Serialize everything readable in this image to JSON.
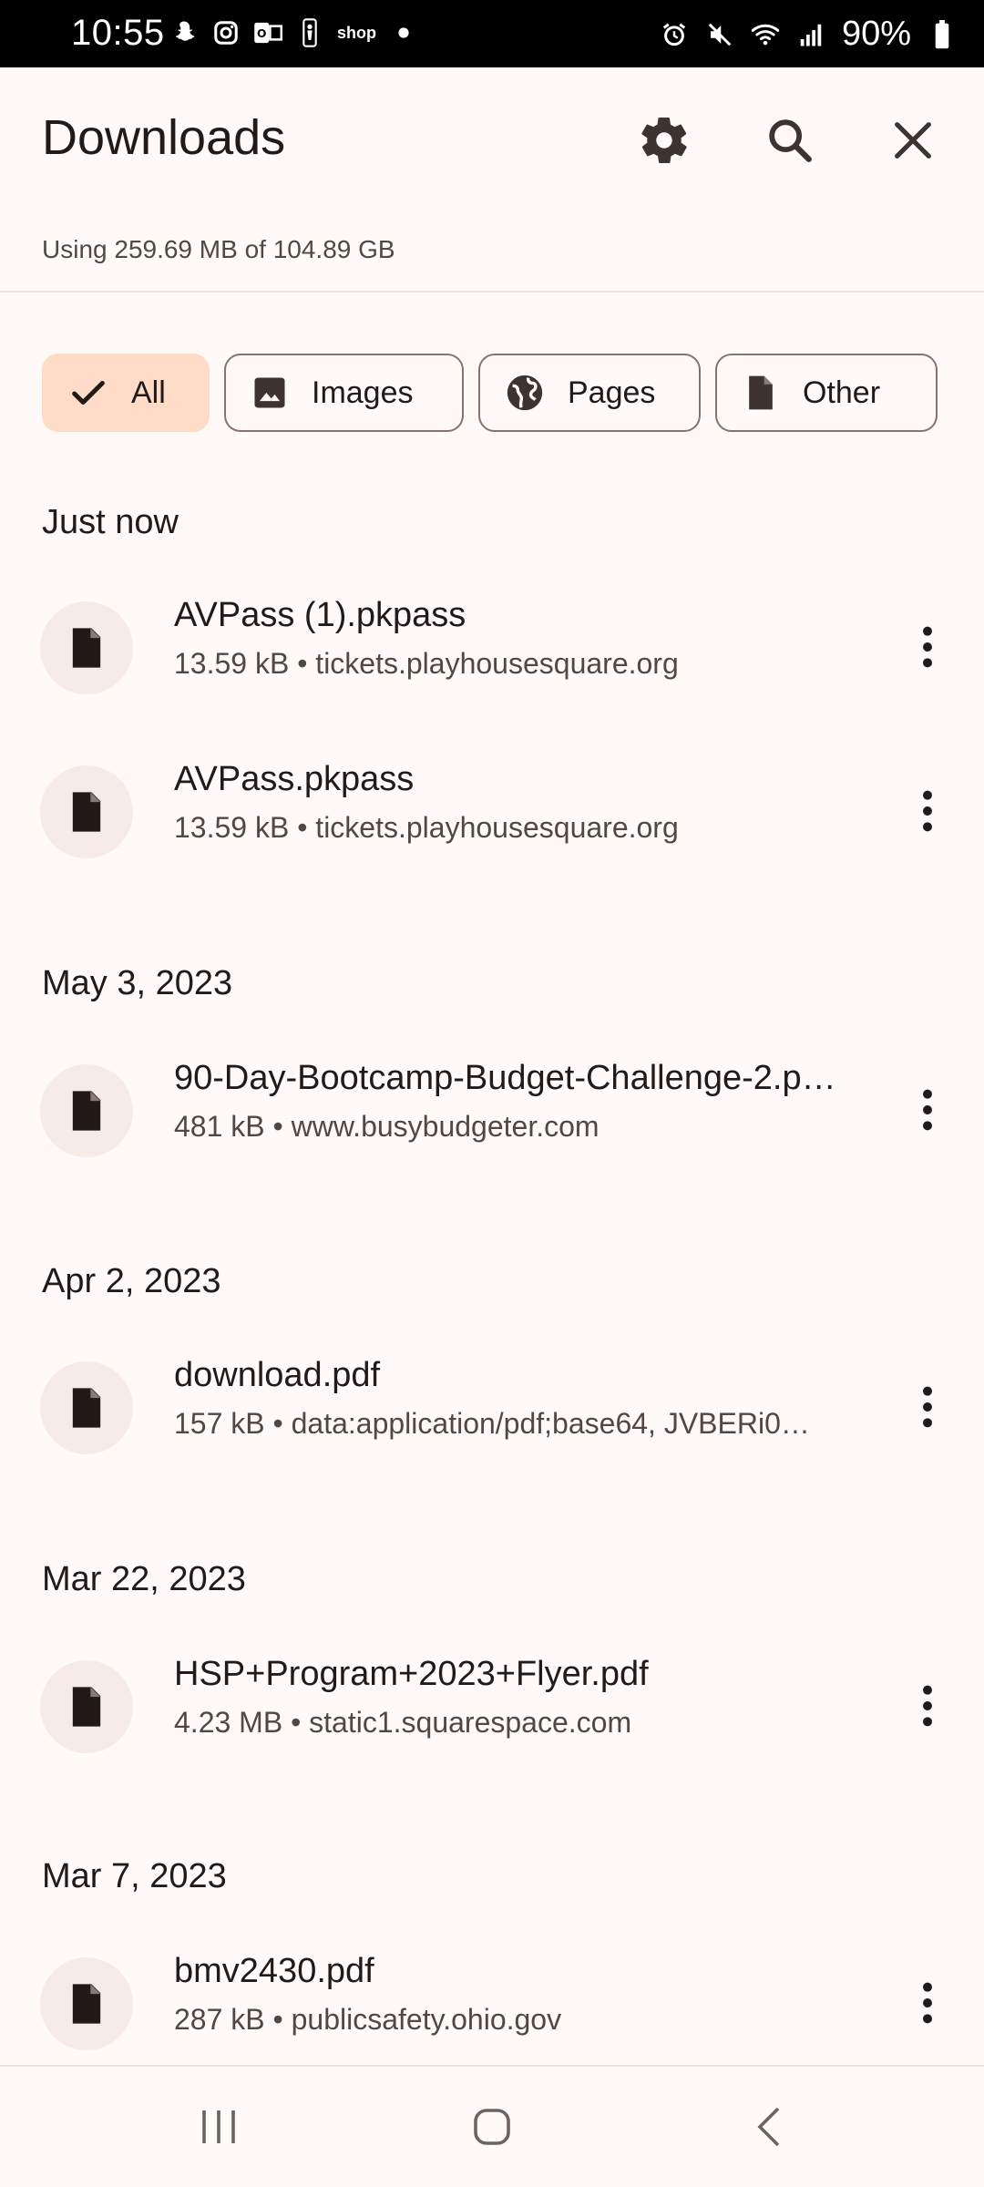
{
  "status_bar": {
    "time": "10:55",
    "battery": "90%",
    "left_icons": [
      "snapchat-icon",
      "instagram-icon",
      "outlook-icon",
      "nba-icon",
      "shop-icon",
      "dot-icon"
    ],
    "shop_label": "shop",
    "right_icons": [
      "alarm-icon",
      "mute-icon",
      "wifi-icon",
      "signal-icon",
      "battery-icon"
    ]
  },
  "header": {
    "title": "Downloads",
    "actions": [
      "settings-icon",
      "search-icon",
      "close-icon"
    ]
  },
  "storage": {
    "text": "Using 259.69 MB of 104.89 GB"
  },
  "filters": [
    {
      "label": "All",
      "icon": "check-icon",
      "selected": true
    },
    {
      "label": "Images",
      "icon": "image-icon",
      "selected": false
    },
    {
      "label": "Pages",
      "icon": "globe-icon",
      "selected": false
    },
    {
      "label": "Other",
      "icon": "file-icon",
      "selected": false
    }
  ],
  "sections": [
    {
      "header": "Just now",
      "items": [
        {
          "name": "AVPass (1).pkpass",
          "meta": "13.59 kB • tickets.playhousesquare.org"
        },
        {
          "name": "AVPass.pkpass",
          "meta": "13.59 kB • tickets.playhousesquare.org"
        }
      ]
    },
    {
      "header": "May 3, 2023",
      "items": [
        {
          "name": "90-Day-Bootcamp-Budget-Challenge-2.p…",
          "meta": "481 kB • www.busybudgeter.com"
        }
      ]
    },
    {
      "header": "Apr 2, 2023",
      "items": [
        {
          "name": "download.pdf",
          "meta": "157 kB • data:application/pdf;base64, JVBERi0…"
        }
      ]
    },
    {
      "header": "Mar 22, 2023",
      "items": [
        {
          "name": "HSP+Program+2023+Flyer.pdf",
          "meta": "4.23 MB • static1.squarespace.com"
        }
      ]
    },
    {
      "header": "Mar 7, 2023",
      "items": [
        {
          "name": "bmv2430.pdf",
          "meta": "287 kB • publicsafety.ohio.gov"
        }
      ]
    }
  ],
  "nav_bar": [
    "recents-icon",
    "home-icon",
    "back-icon"
  ],
  "colors": {
    "background": "#fffaf8",
    "chip_selected": "#ffdbc8",
    "avatar_bg": "#f6ebe7",
    "text_primary": "#211a18",
    "text_secondary": "#524743"
  }
}
